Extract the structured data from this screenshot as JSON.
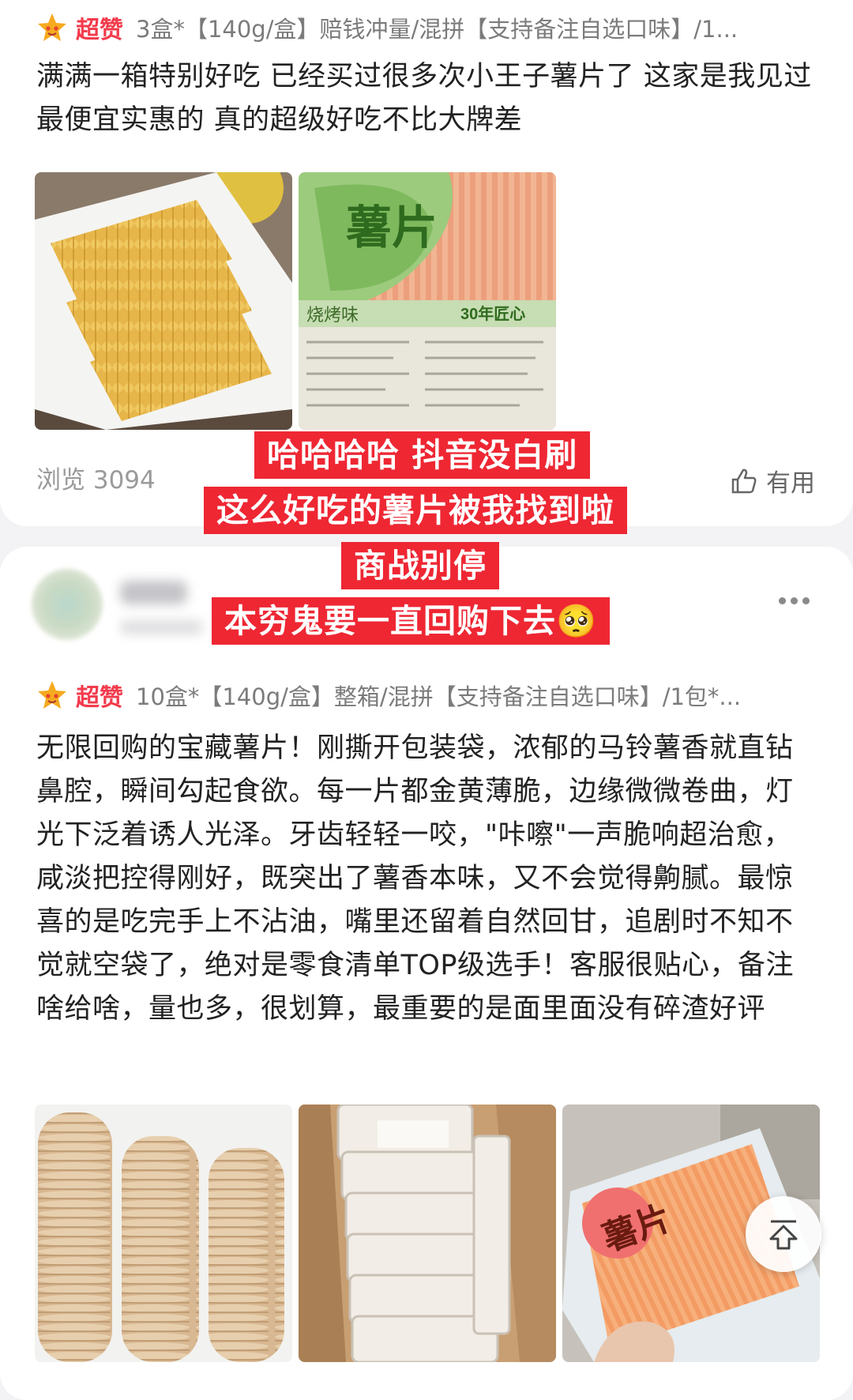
{
  "review1": {
    "rating_label": "超赞",
    "spec": "3盒*【140g/盒】赔钱冲量/混拼【支持备注自选口味】/1...",
    "text": "满满一箱特别好吃 已经买过很多次小王子薯片了 这家是我见过最便宜实惠的 真的超级好吃不比大牌差",
    "photos": [
      {
        "name": "chips-tray-photo"
      },
      {
        "name": "chips-package-photo",
        "brand_text": "薯片",
        "flavor_text": "烧烤味",
        "badge_text": "30年匠心"
      }
    ],
    "views": "浏览 3094",
    "useful_label": "有用"
  },
  "captions": [
    "哈哈哈哈  抖音没白刷",
    "这么好吃的薯片被我找到啦",
    "商战别停",
    "本穷鬼要一直回购下去🥺"
  ],
  "review2": {
    "rating_label": "超赞",
    "spec": "10盒*【140g/盒】整箱/混拼【支持备注自选口味】/1包*...",
    "text": "无限回购的宝藏薯片！刚撕开包装袋，浓郁的马铃薯香就直钻鼻腔，瞬间勾起食欲。每一片都金黄薄脆，边缘微微卷曲，灯光下泛着诱人光泽。牙齿轻轻一咬，\"咔嚓\"一声脆响超治愈，咸淡把控得刚好，既突出了薯香本味，又不会觉得齁腻。最惊喜的是吃完手上不沾油，嘴里还留着自然回甘，追剧时不知不觉就空袋了，绝对是零食清单TOP级选手！客服很贴心，备注啥给啥，量也多，很划算，最重要的是面里面没有碎渣好评",
    "photos": [
      {
        "name": "chips-stacks-photo"
      },
      {
        "name": "box-of-trays-photo"
      },
      {
        "name": "hand-holding-package-photo",
        "brand_text": "薯片"
      }
    ]
  },
  "colors": {
    "accent_red": "#f23b4c",
    "caption_bg": "#ee2733",
    "text_dark": "#222222",
    "text_gray": "#7b7b7b"
  },
  "icons": [
    "star-face-icon",
    "thumbs-up-icon",
    "more-dots-icon",
    "scroll-top-icon"
  ]
}
